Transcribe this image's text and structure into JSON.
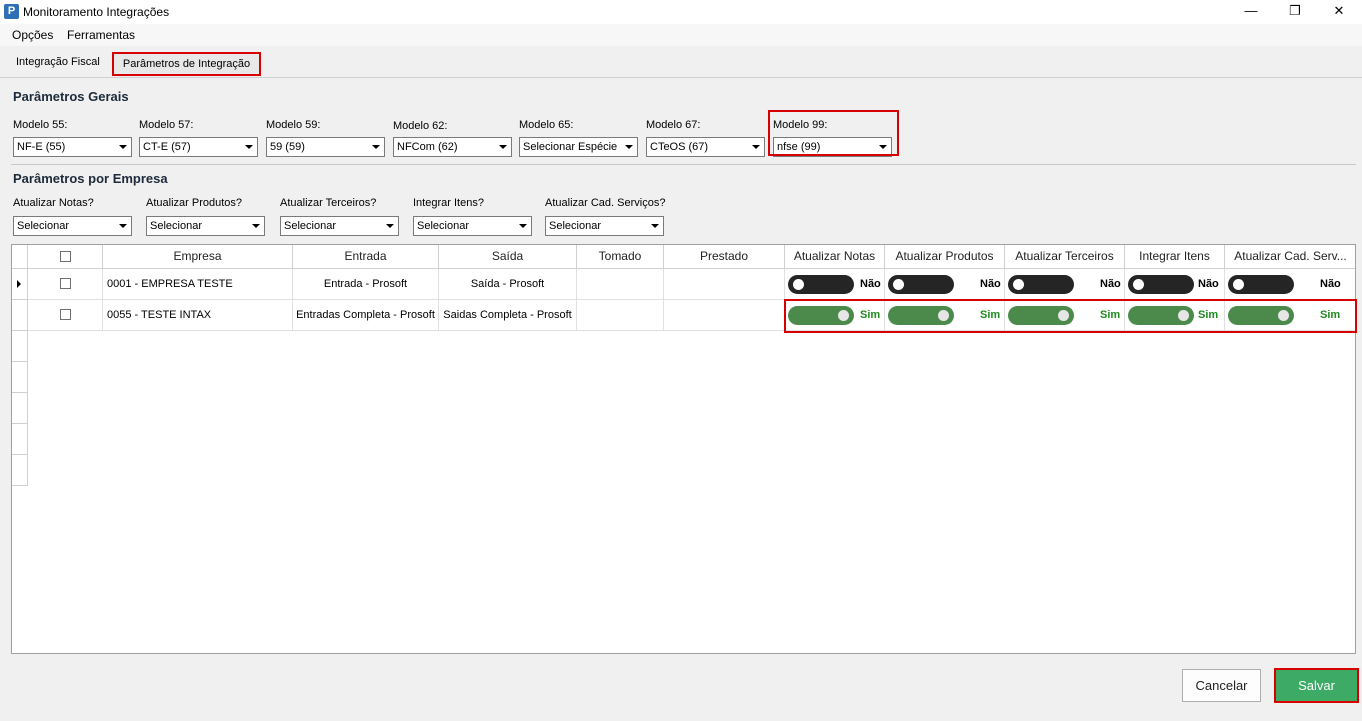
{
  "window": {
    "title": "Monitoramento Integrações",
    "logo": "P",
    "controls": {
      "minimize": "—",
      "maximize": "❐",
      "close": "✕"
    }
  },
  "menu": {
    "items": [
      "Opções",
      "Ferramentas"
    ]
  },
  "tabs": {
    "integracao_fiscal": "Integração Fiscal",
    "parametros": "Parâmetros de Integração",
    "active": "Parâmetros de Integração"
  },
  "gerais": {
    "title": "Parâmetros Gerais",
    "fields": [
      {
        "label": "Modelo 55:",
        "value": "NF-E (55)"
      },
      {
        "label": "Modelo 57:",
        "value": "CT-E (57)"
      },
      {
        "label": "Modelo 59:",
        "value": "59 (59)"
      },
      {
        "label": "Modelo 62:",
        "value": "NFCom (62)"
      },
      {
        "label": "Modelo 65:",
        "value": "Selecionar Espécie"
      },
      {
        "label": "Modelo 67:",
        "value": "CTeOS (67)"
      },
      {
        "label": "Modelo 99:",
        "value": "nfse (99)"
      }
    ]
  },
  "empresa": {
    "title": "Parâmetros por Empresa",
    "fields": [
      {
        "label": "Atualizar Notas?",
        "value": "Selecionar"
      },
      {
        "label": "Atualizar Produtos?",
        "value": "Selecionar"
      },
      {
        "label": "Atualizar Terceiros?",
        "value": "Selecionar"
      },
      {
        "label": "Integrar Itens?",
        "value": "Selecionar"
      },
      {
        "label": "Atualizar Cad. Serviços?",
        "value": "Selecionar"
      }
    ]
  },
  "grid": {
    "columns": [
      "Empresa",
      "Entrada",
      "Saída",
      "Tomado",
      "Prestado",
      "Atualizar Notas",
      "Atualizar Produtos",
      "Atualizar Terceiros",
      "Integrar Itens",
      "Atualizar Cad. Serv..."
    ],
    "rows": [
      {
        "empresa": "0001 - EMPRESA TESTE",
        "entrada": "Entrada - Prosoft",
        "saida": "Saída - Prosoft",
        "tomado": "",
        "prestado": "",
        "toggles": [
          false,
          false,
          false,
          false,
          false
        ],
        "labels": [
          "Não",
          "Não",
          "Não",
          "Não",
          "Não"
        ],
        "current": true
      },
      {
        "empresa": "0055 - TESTE INTAX",
        "entrada": "Entradas Completa - Prosoft",
        "saida": "Saidas Completa - Prosoft",
        "tomado": "",
        "prestado": "",
        "toggles": [
          true,
          true,
          true,
          true,
          true
        ],
        "labels": [
          "Sim",
          "Sim",
          "Sim",
          "Sim",
          "Sim"
        ],
        "current": false
      }
    ]
  },
  "buttons": {
    "cancel": "Cancelar",
    "save": "Salvar"
  },
  "colors": {
    "highlight": "#d60000",
    "toggle_on": "#4c8a4c",
    "toggle_off": "#252525",
    "save": "#3daa66"
  }
}
